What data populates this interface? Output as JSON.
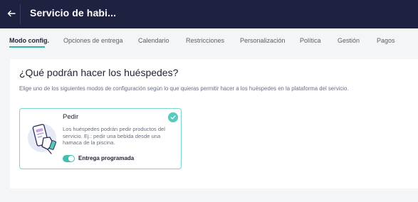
{
  "header": {
    "title": "Servicio de habi...",
    "back_icon": "arrow-left-icon",
    "caret_glyph": "◇",
    "background": "#1e2240"
  },
  "tabs": [
    {
      "label": "Modo config.",
      "active": true
    },
    {
      "label": "Opciones de entrega",
      "active": false
    },
    {
      "label": "Calendario",
      "active": false
    },
    {
      "label": "Restricciones",
      "active": false
    },
    {
      "label": "Personalización",
      "active": false
    },
    {
      "label": "Política",
      "active": false
    },
    {
      "label": "Gestión",
      "active": false
    },
    {
      "label": "Pagos",
      "active": false
    }
  ],
  "main": {
    "heading": "¿Qué podrán hacer los huéspedes?",
    "subtitle": "Elige uno de los siguientes modos de configuración según lo que quieras permitir hacer a los huéspedes en la plataforma del servicio.",
    "mode_card": {
      "title": "Pedir",
      "description": "Los huéspedes podrán pedir productos del servicio. Ej.: pedir una bebida desde una hamaca de la piscina.",
      "selected": true,
      "illustration": "phone-order-illustration-icon",
      "toggle": {
        "label": "Entrega programada",
        "on": true
      }
    }
  },
  "colors": {
    "accent": "#2fb7a8",
    "check": "#58cabd",
    "card_border": "#7fd3c8"
  }
}
